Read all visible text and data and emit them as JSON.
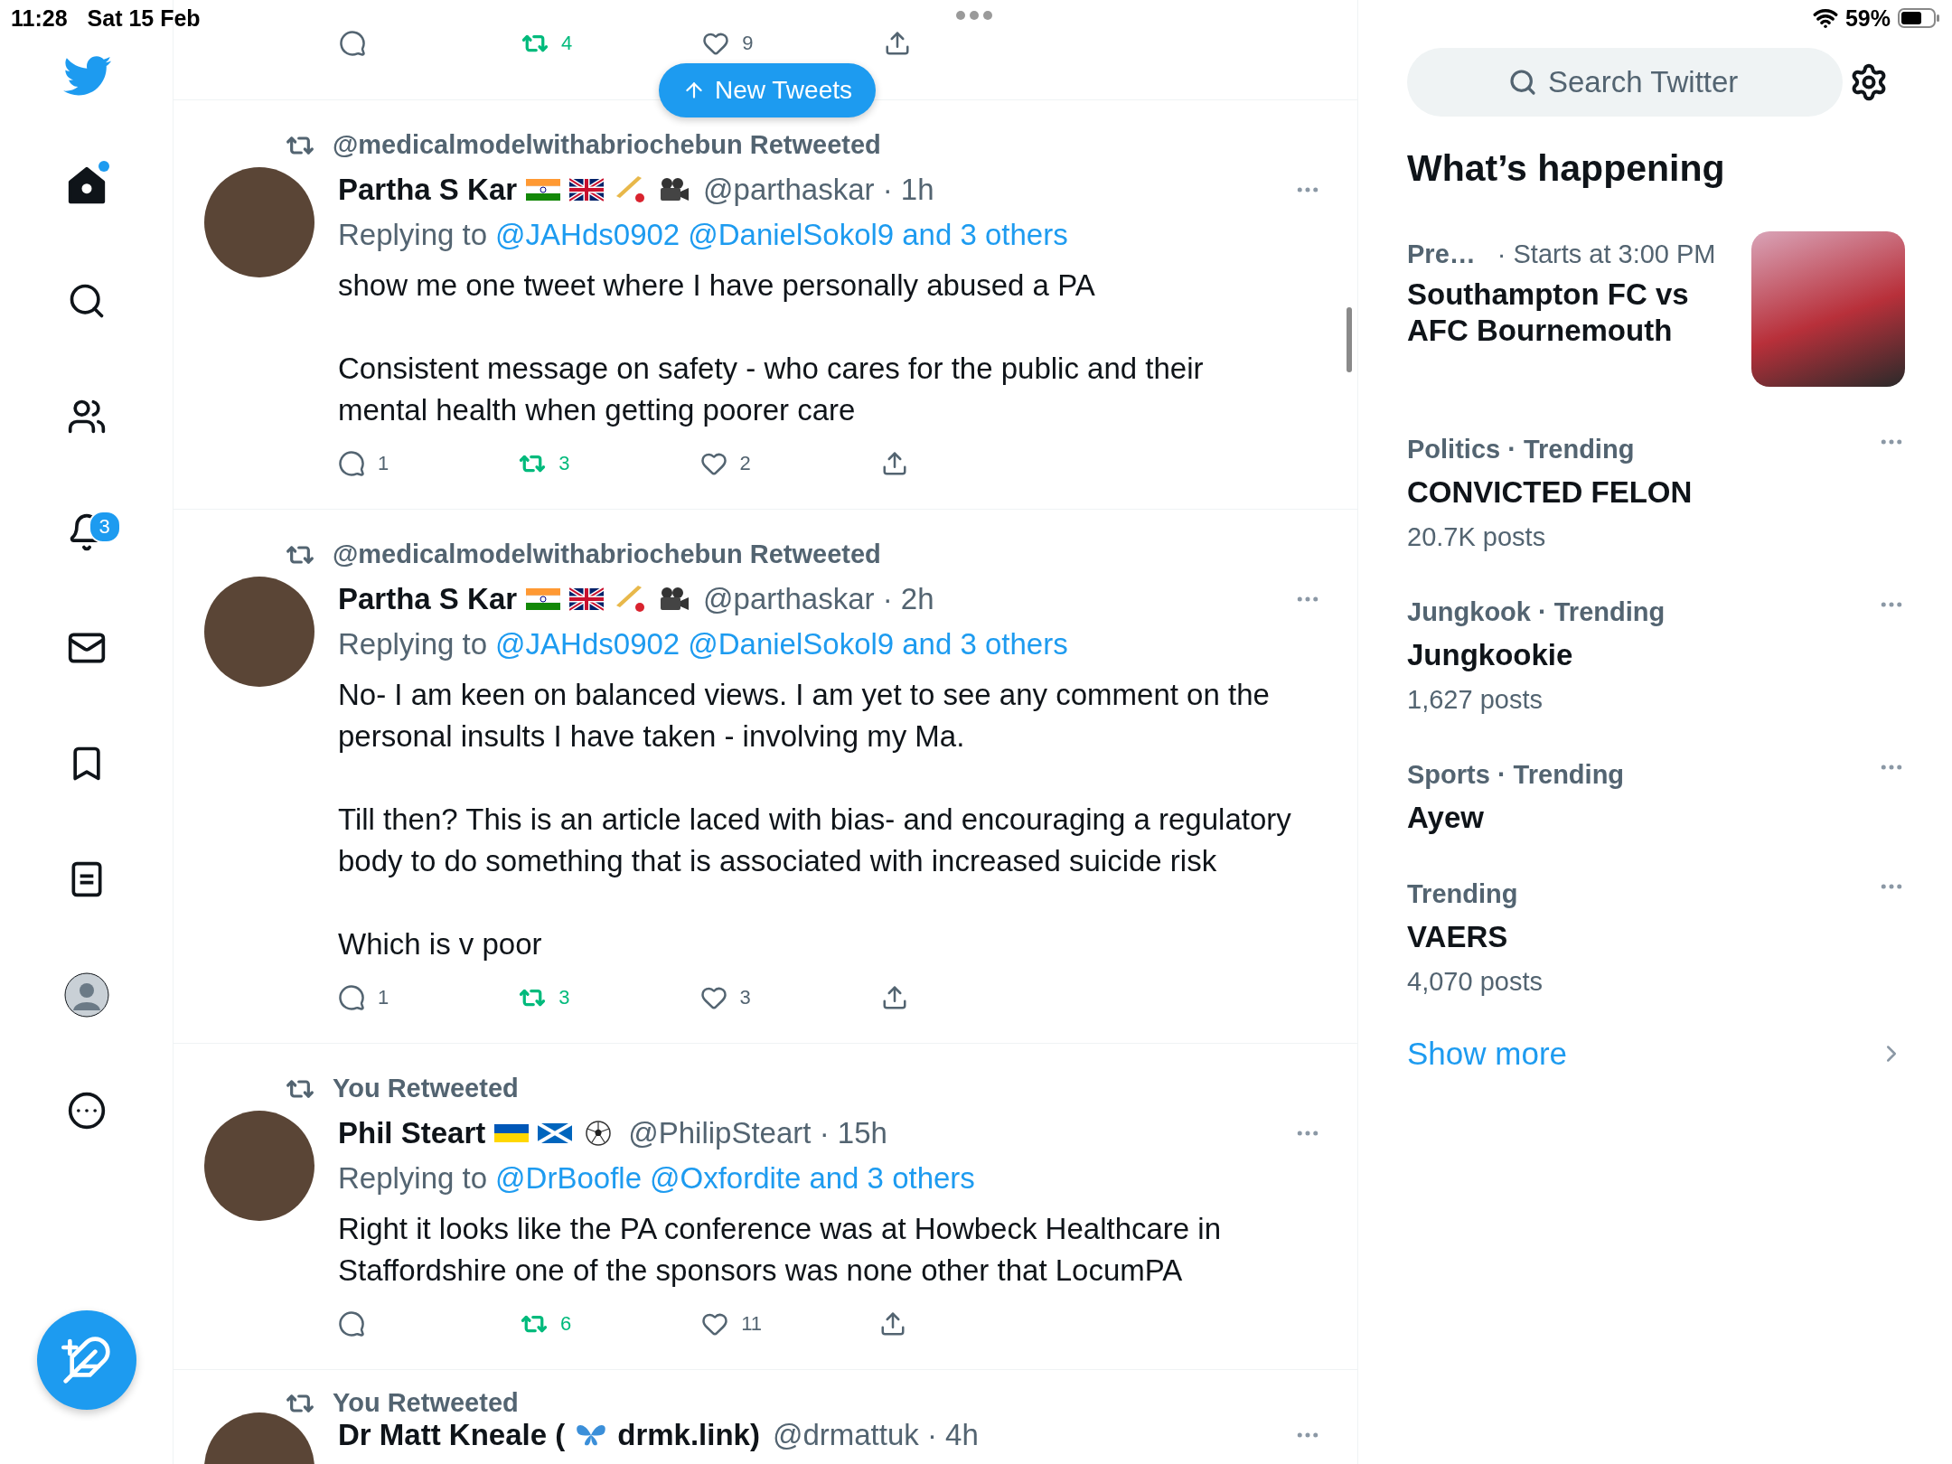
{
  "status_bar": {
    "time": "11:28",
    "date": "Sat 15 Feb",
    "battery": "59%"
  },
  "nav": {
    "items": [
      {
        "kind": "home",
        "selected": true,
        "dot": true
      },
      {
        "kind": "search",
        "selected": false,
        "dot": false
      },
      {
        "kind": "communities",
        "selected": false,
        "dot": false
      },
      {
        "kind": "notifications",
        "selected": false,
        "dot": false,
        "badge": "3"
      },
      {
        "kind": "messages",
        "selected": false,
        "dot": false
      },
      {
        "kind": "bookmarks",
        "selected": false,
        "dot": false
      },
      {
        "kind": "lists",
        "selected": false,
        "dot": false
      },
      {
        "kind": "profile",
        "selected": false,
        "dot": false
      },
      {
        "kind": "more",
        "selected": false,
        "dot": false
      }
    ]
  },
  "new_tweets_button": {
    "label": "New Tweets"
  },
  "feed": {
    "partial_top": {
      "actions": {
        "retweet": "4",
        "like": "9",
        "retweeted": true,
        "liked": false
      }
    },
    "tweets": [
      {
        "retweeted_by": "@medicalmodelwithabriochebun Retweeted",
        "name_parts": [
          {
            "kind": "text",
            "text": "Partha S Kar"
          },
          {
            "kind": "flag_in"
          },
          {
            "kind": "flag_uk"
          },
          {
            "kind": "cricket"
          },
          {
            "kind": "camera"
          }
        ],
        "meta": "@parthaskar · 1h",
        "replying_to": {
          "label": "Replying to",
          "links": [
            "@JAHds0902",
            "@DanielSokol9",
            "and 3 others"
          ]
        },
        "body": [
          "show me one tweet where I have personally abused a PA",
          "Consistent message on safety - who cares for the public and their mental health when getting poorer care"
        ],
        "actions": {
          "reply": "1",
          "retweet": "3",
          "like": "2",
          "retweeted": true,
          "liked": false
        }
      },
      {
        "retweeted_by": "@medicalmodelwithabriochebun Retweeted",
        "name_parts": [
          {
            "kind": "text",
            "text": "Partha S Kar"
          },
          {
            "kind": "flag_in"
          },
          {
            "kind": "flag_uk"
          },
          {
            "kind": "cricket"
          },
          {
            "kind": "camera"
          }
        ],
        "meta": "@parthaskar · 2h",
        "replying_to": {
          "label": "Replying to",
          "links": [
            "@JAHds0902",
            "@DanielSokol9",
            "and 3 others"
          ]
        },
        "body": [
          "No- I am keen on balanced views. I am yet to see any comment on the personal insults I have taken - involving my Ma.",
          "Till then? This is an article laced with bias- and encouraging a regulatory body to do something that is associated with increased suicide risk",
          "Which is v poor"
        ],
        "actions": {
          "reply": "1",
          "retweet": "3",
          "like": "3",
          "retweeted": true,
          "liked": false
        }
      },
      {
        "retweeted_by": "You Retweeted",
        "name_parts": [
          {
            "kind": "text",
            "text": "Phil Steart"
          },
          {
            "kind": "flag_ua"
          },
          {
            "kind": "flag_scot"
          },
          {
            "kind": "soccer"
          }
        ],
        "meta": "@PhilipSteart · 15h",
        "replying_to": {
          "label": "Replying to",
          "links": [
            "@DrBoofle",
            "@Oxfordite",
            "and 3 others"
          ]
        },
        "body": [
          "Right it looks like the PA conference was at Howbeck Healthcare in Staffordshire one of the sponsors was none other that LocumPA"
        ],
        "actions": {
          "retweet": "6",
          "like": "11",
          "retweeted": true,
          "liked": false
        }
      },
      {
        "retweeted_by": "You Retweeted",
        "name_parts": [
          {
            "kind": "text",
            "text": "Dr Matt Kneale ("
          },
          {
            "kind": "butterfly"
          },
          {
            "kind": "text",
            "text": "drmk.link)"
          }
        ],
        "meta": "@drmattuk · 4h"
      }
    ]
  },
  "sidebar": {
    "search": {
      "placeholder": "Search Twitter"
    },
    "heading": "What’s happening",
    "trends": [
      {
        "kind": "event",
        "category": "Pre…",
        "detail": "· Starts at 3:00 PM",
        "title": "Southampton FC vs AFC Bournemouth"
      },
      {
        "kind": "trend",
        "category": "Politics · Trending",
        "title": "CONVICTED FELON",
        "posts": "20.7K posts"
      },
      {
        "kind": "trend",
        "category": "Jungkook · Trending",
        "title": "Jungkookie",
        "posts": "1,627 posts"
      },
      {
        "kind": "trend",
        "category": "Sports · Trending",
        "title": "Ayew"
      },
      {
        "kind": "trend",
        "category": "Trending",
        "title": "VAERS",
        "posts": "4,070 posts"
      }
    ],
    "show_more": "Show more"
  }
}
